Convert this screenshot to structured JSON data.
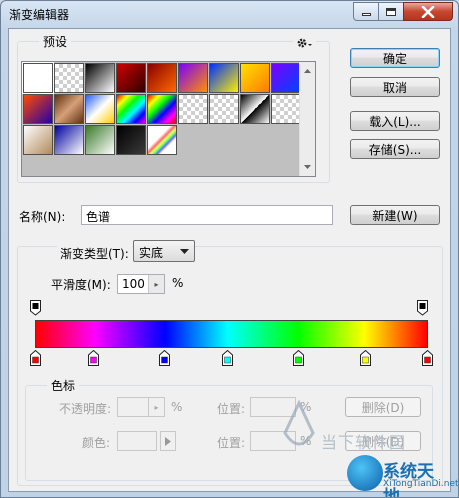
{
  "window": {
    "title": "渐变编辑器"
  },
  "presets": {
    "label": "预设",
    "swatches": [
      "linear-gradient(135deg,#ffffff,#ffffff)",
      "checker-white",
      "linear-gradient(135deg,#000,#fff)",
      "linear-gradient(135deg,#d00000,#300000)",
      "linear-gradient(135deg,#8a0000,#ff6a00)",
      "linear-gradient(135deg,#7a00ff,#ff9000)",
      "linear-gradient(135deg,#0030ff,#ffee00)",
      "linear-gradient(135deg,#ffe100,#ff7b00)",
      "linear-gradient(135deg,#7a00ff,#0044ff)",
      "linear-gradient(135deg,#ff4a00,#2200aa)",
      "linear-gradient(135deg,#603010,#d7a07a,#603010)",
      "linear-gradient(135deg,#2b5fff,#ffffff,#ffcc00)",
      "linear-gradient(135deg,#ff0000,#ffff00,#00ff00,#00ffff,#0000ff,#ff00ff)",
      "linear-gradient(135deg,#ff0000,#ffff00,#00ff00,#0000ff,#ff00ff,#ff0000)",
      "checker-diag",
      "checker-white",
      "linear-gradient(135deg,#000 0%,#fff 50%,#000 50%,#fff 100%)",
      "checker-white",
      "linear-gradient(135deg,#ffffff,#b08a5a)",
      "linear-gradient(135deg,#0000a0,#ffffff)",
      "linear-gradient(135deg,#3a7a2a,#ffffff)",
      "linear-gradient(135deg,#000000,#3a3a3a)",
      "checker-rainbow"
    ],
    "icon": "gear-icon"
  },
  "buttons": {
    "ok": "确定",
    "cancel": "取消",
    "load": "载入(L)...",
    "save": "存储(S)...",
    "new": "新建(W)"
  },
  "name": {
    "label": "名称(N):",
    "value": "色谱"
  },
  "gradient_type": {
    "label": "渐变类型(T):",
    "value": "实底"
  },
  "smoothness": {
    "label": "平滑度(M):",
    "value": "100",
    "unit": "%"
  },
  "color_stops": {
    "group_label": "色标",
    "opacity_label": "不透明度:",
    "opacity_unit": "%",
    "position_label_1": "位置:",
    "position_unit_1": "%",
    "delete_label_1": "删除(D)",
    "color_label": "颜色:",
    "position_label_2": "位置:",
    "position_unit_2": "%",
    "delete_label_2": "删除(D)",
    "stops": [
      {
        "color": "#ff0000",
        "location": 0
      },
      {
        "color": "#ff00ff",
        "location": 15
      },
      {
        "color": "#0000ff",
        "location": 33
      },
      {
        "color": "#00ffff",
        "location": 49
      },
      {
        "color": "#00ff00",
        "location": 67
      },
      {
        "color": "#ffff00",
        "location": 84
      },
      {
        "color": "#ff0000",
        "location": 100
      }
    ],
    "opacity_stops": [
      0,
      100
    ]
  },
  "watermark": {
    "line1": "当下软件园",
    "line2": "系统天地",
    "line3": "XiTongTianDi.net"
  }
}
